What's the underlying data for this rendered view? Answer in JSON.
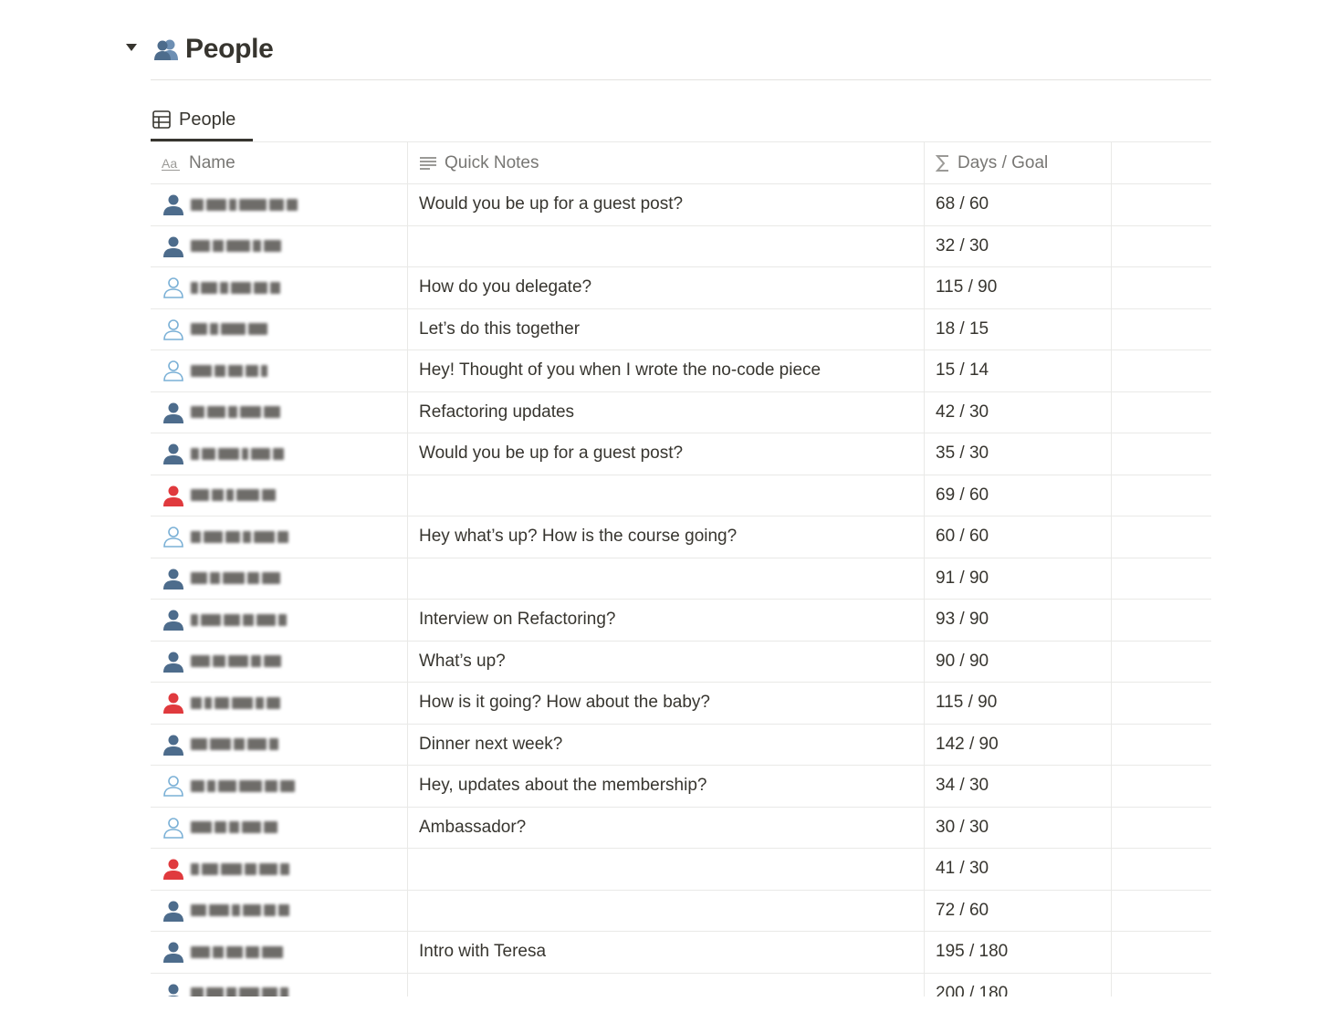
{
  "page": {
    "title": "People",
    "title_icon": "people-icon"
  },
  "view": {
    "tab_label": "People",
    "tab_icon": "table-icon"
  },
  "table": {
    "columns": [
      {
        "label": "Name",
        "icon": "text-property-icon"
      },
      {
        "label": "Quick Notes",
        "icon": "lines-icon"
      },
      {
        "label": "Days / Goal",
        "icon": "sigma-icon"
      }
    ],
    "add_column_label": "+",
    "more_label": "···",
    "rows": [
      {
        "status": "filled",
        "note": "Would you be up for a guest post?",
        "days": "68 / 60"
      },
      {
        "status": "filled",
        "note": "",
        "days": "32 / 30"
      },
      {
        "status": "outline",
        "note": "How do you delegate?",
        "days": "115 / 90"
      },
      {
        "status": "outline",
        "note": "Let’s do this together",
        "days": "18 / 15"
      },
      {
        "status": "outline",
        "note": "Hey! Thought of you when I wrote the no-code piece",
        "days": "15 / 14"
      },
      {
        "status": "filled",
        "note": "Refactoring updates",
        "days": "42 / 30"
      },
      {
        "status": "filled",
        "note": "Would you be up for a guest post?",
        "days": "35 / 30"
      },
      {
        "status": "red",
        "note": "",
        "days": "69 / 60"
      },
      {
        "status": "outline",
        "note": "Hey what’s up? How is the course going?",
        "days": "60 / 60"
      },
      {
        "status": "filled",
        "note": "",
        "days": "91 / 90"
      },
      {
        "status": "filled",
        "note": "Interview on Refactoring?",
        "days": "93 / 90"
      },
      {
        "status": "filled",
        "note": "What’s up?",
        "days": "90 / 90"
      },
      {
        "status": "red",
        "note": "How is it going? How about the baby?",
        "days": "115 / 90"
      },
      {
        "status": "filled",
        "note": "Dinner next week?",
        "days": "142 / 90"
      },
      {
        "status": "outline",
        "note": "Hey, updates about the membership?",
        "days": "34 / 30"
      },
      {
        "status": "outline",
        "note": "Ambassador?",
        "days": "30 / 30"
      },
      {
        "status": "red",
        "note": "",
        "days": "41 / 30"
      },
      {
        "status": "filled",
        "note": "",
        "days": "72 / 60"
      },
      {
        "status": "filled",
        "note": "Intro with Teresa",
        "days": "195 / 180"
      },
      {
        "status": "filled",
        "note": "",
        "days": "200 / 180"
      }
    ]
  },
  "colors": {
    "filled": "#4d6c8c",
    "outline": "#7ab0d6",
    "red": "#e03a3e",
    "text": "#37352f",
    "muted": "#787774"
  }
}
